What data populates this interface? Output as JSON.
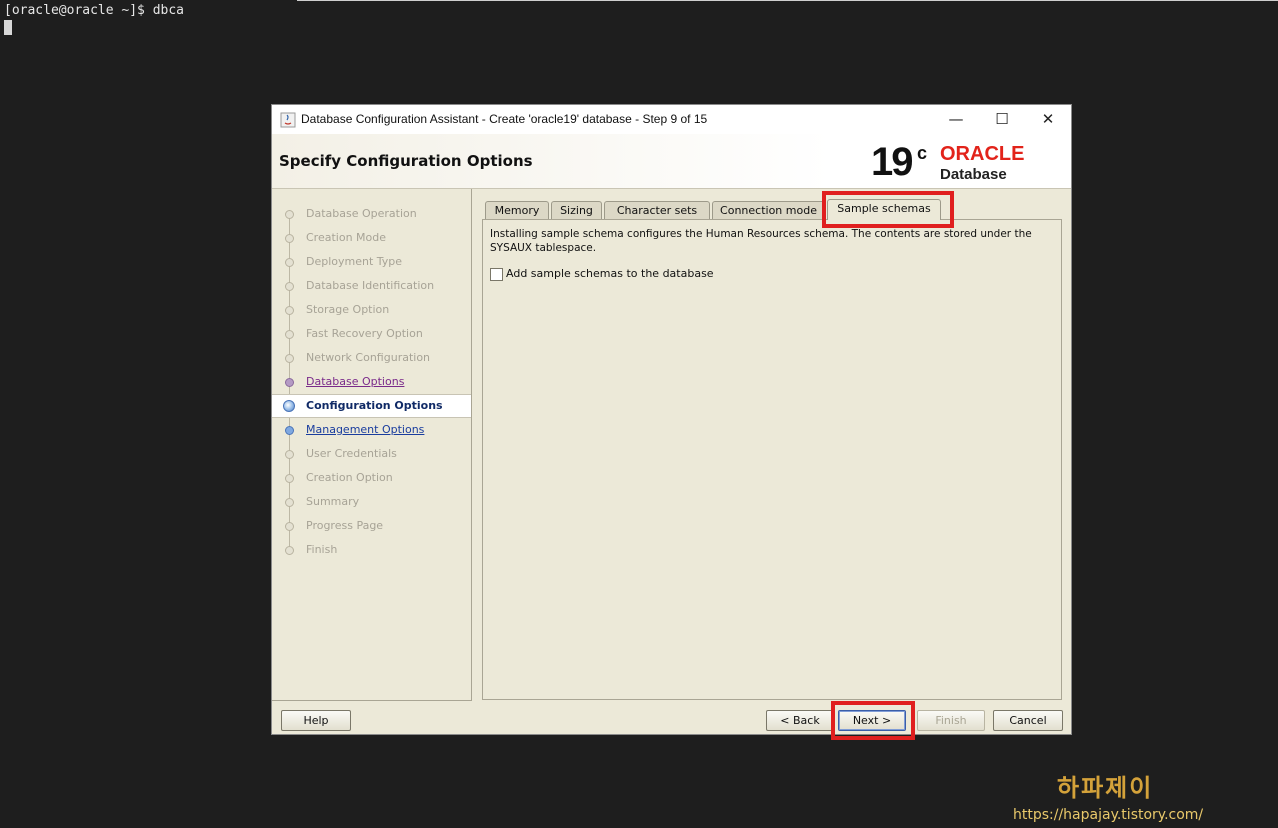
{
  "terminal": {
    "prompt_line": "[oracle@oracle ~]$ dbca"
  },
  "window": {
    "title": "Database Configuration Assistant - Create 'oracle19' database - Step 9 of 15",
    "controls": {
      "minimize": "—",
      "maximize": "☐",
      "close": "✕"
    }
  },
  "header": {
    "page_title": "Specify Configuration Options",
    "logo": {
      "version": "19",
      "superscript": "c",
      "brand": "ORACLE",
      "product": "Database"
    }
  },
  "steps": [
    {
      "label": "Database Operation",
      "state": "disabled"
    },
    {
      "label": "Creation Mode",
      "state": "disabled"
    },
    {
      "label": "Deployment Type",
      "state": "disabled"
    },
    {
      "label": "Database Identification",
      "state": "disabled"
    },
    {
      "label": "Storage Option",
      "state": "disabled"
    },
    {
      "label": "Fast Recovery Option",
      "state": "disabled"
    },
    {
      "label": "Network Configuration",
      "state": "disabled"
    },
    {
      "label": "Database Options",
      "state": "visited"
    },
    {
      "label": "Configuration Options",
      "state": "current"
    },
    {
      "label": "Management Options",
      "state": "next"
    },
    {
      "label": "User Credentials",
      "state": "disabled"
    },
    {
      "label": "Creation Option",
      "state": "disabled"
    },
    {
      "label": "Summary",
      "state": "disabled"
    },
    {
      "label": "Progress Page",
      "state": "disabled"
    },
    {
      "label": "Finish",
      "state": "disabled"
    }
  ],
  "tabs": [
    {
      "label": "Memory",
      "selected": false
    },
    {
      "label": "Sizing",
      "selected": false
    },
    {
      "label": "Character sets",
      "selected": false
    },
    {
      "label": "Connection mode",
      "selected": false
    },
    {
      "label": "Sample schemas",
      "selected": true
    }
  ],
  "sample_schemas": {
    "description": "Installing sample schema configures the Human Resources schema. The contents are stored under the SYSAUX tablespace.",
    "checkbox_label": "Add sample schemas to the database",
    "checked": false
  },
  "buttons": {
    "help": "Help",
    "back": "< Back",
    "next": "Next >",
    "finish": "Finish",
    "cancel": "Cancel"
  },
  "watermark": {
    "korean": "하파제이",
    "url": "https://hapajay.tistory.com/"
  },
  "colors": {
    "highlight": "#e01f1f",
    "oracle_red": "#e2231a"
  }
}
